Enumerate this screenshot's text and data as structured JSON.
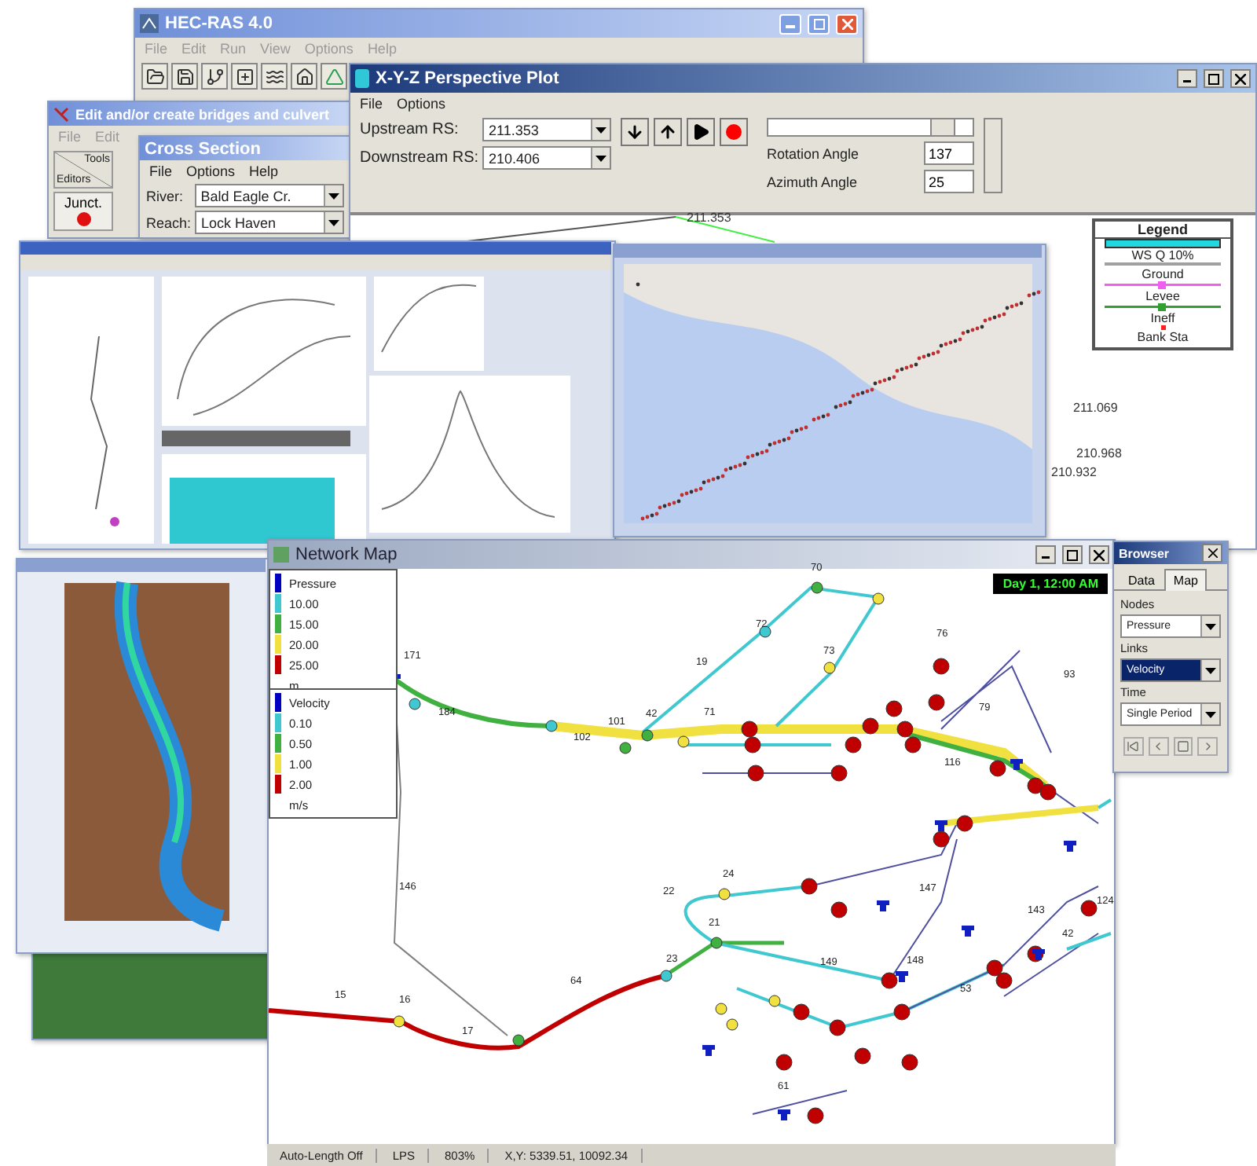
{
  "hecras": {
    "title": "HEC-RAS 4.0",
    "menu": [
      "File",
      "Edit",
      "Run",
      "View",
      "Options",
      "Help"
    ]
  },
  "bridges": {
    "title": "Edit and/or create bridges and culvert",
    "menu": [
      "File",
      "Edit"
    ],
    "header_top": "Tools",
    "header_bottom": "Editors",
    "tool": "Junct."
  },
  "cross_section": {
    "title": "Cross Section",
    "menu": [
      "File",
      "Options",
      "Help"
    ],
    "fields": [
      {
        "label": "River:",
        "value": "Bald Eagle Cr."
      },
      {
        "label": "Reach:",
        "value": "Lock Haven"
      }
    ]
  },
  "xyz_plot": {
    "title": "X-Y-Z Perspective Plot",
    "menu": [
      "File",
      "Options"
    ],
    "selectors": [
      {
        "label": "Upstream RS:",
        "value": "211.353"
      },
      {
        "label": "Downstream RS:",
        "value": "210.406"
      }
    ],
    "slider": {
      "level": 0.9
    },
    "angles": [
      {
        "label": "Rotation Angle",
        "value": "137"
      },
      {
        "label": "Azimuth Angle",
        "value": "25"
      }
    ],
    "station_labels": [
      "211.353",
      "211.069",
      "210.968",
      "210.932"
    ],
    "legend": {
      "title": "Legend",
      "items": [
        {
          "label": "WS Q 10%",
          "kind": "band",
          "color": "#20d8e0"
        },
        {
          "label": "Ground",
          "kind": "line",
          "color": "#a0a0a0"
        },
        {
          "label": "Levee",
          "kind": "line-dot",
          "color": "#f060f0"
        },
        {
          "label": "Ineff",
          "kind": "line-dot",
          "color": "#30a030"
        },
        {
          "label": "Bank Sta",
          "kind": "dot",
          "color": "#ff2020"
        }
      ]
    }
  },
  "network_map": {
    "title": "Network Map",
    "time": "Day 1, 12:00 AM",
    "legends": [
      {
        "unit": "m",
        "items": [
          {
            "label": "Pressure",
            "color": "#0000c0"
          },
          {
            "label": "10.00",
            "color": "#40c8d0"
          },
          {
            "label": "15.00",
            "color": "#40b040"
          },
          {
            "label": "20.00",
            "color": "#f0e040"
          },
          {
            "label": "25.00",
            "color": "#c00000"
          }
        ]
      },
      {
        "unit": "m/s",
        "items": [
          {
            "label": "Velocity",
            "color": "#0000c0"
          },
          {
            "label": "0.10",
            "color": "#40c8d0"
          },
          {
            "label": "0.50",
            "color": "#40b040"
          },
          {
            "label": "1.00",
            "color": "#f0e040"
          },
          {
            "label": "2.00",
            "color": "#c00000"
          }
        ]
      }
    ],
    "labels": [
      "171",
      "184",
      "102",
      "101",
      "42",
      "71",
      "19",
      "72",
      "70",
      "73",
      "79",
      "116",
      "76",
      "93",
      "15",
      "16",
      "17",
      "64",
      "146",
      "21",
      "22",
      "24",
      "23",
      "149",
      "148",
      "147",
      "143",
      "124",
      "53",
      "42",
      "61"
    ],
    "status": [
      "Auto-Length Off",
      "LPS",
      "803%",
      "X,Y: 5339.51, 10092.34"
    ]
  },
  "browser": {
    "title": "Browser",
    "tabs": [
      {
        "label": "Data",
        "selected": false
      },
      {
        "label": "Map",
        "selected": true
      }
    ],
    "selects": [
      {
        "label": "Nodes",
        "value": "Pressure",
        "highlighted": false
      },
      {
        "label": "Links",
        "value": "Velocity",
        "highlighted": true
      },
      {
        "label": "Time",
        "value": "Single Period",
        "highlighted": false
      }
    ]
  }
}
